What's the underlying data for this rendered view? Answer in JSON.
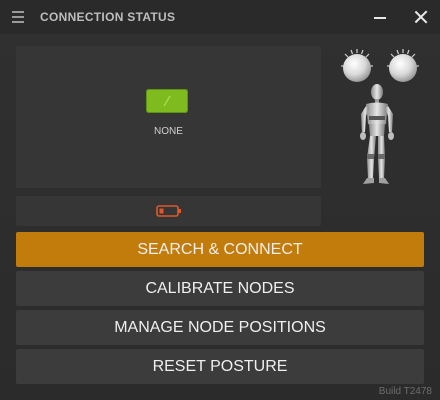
{
  "window": {
    "title": "CONNECTION STATUS"
  },
  "icons": {
    "menu": "hamburger-menu-icon",
    "minimize": "minimize-icon",
    "close": "close-icon",
    "connection": "connection-status-icon",
    "battery": "low-battery-icon",
    "dial_left": "dial-knob-icon",
    "dial_right": "dial-knob-icon",
    "figure": "humanoid-figure-icon"
  },
  "status": {
    "label": "NONE"
  },
  "buttons": {
    "search_connect": "SEARCH & CONNECT",
    "calibrate": "CALIBRATE NODES",
    "manage_positions": "MANAGE NODE POSITIONS",
    "reset_posture": "RESET POSTURE"
  },
  "footer": {
    "build": "Build T2478"
  },
  "colors": {
    "accent": "#c17c0c",
    "status_green": "#7dbb1f",
    "battery_warning": "#e2572a",
    "button_bg": "#3c3c3c",
    "panel_bg": "#363636"
  }
}
